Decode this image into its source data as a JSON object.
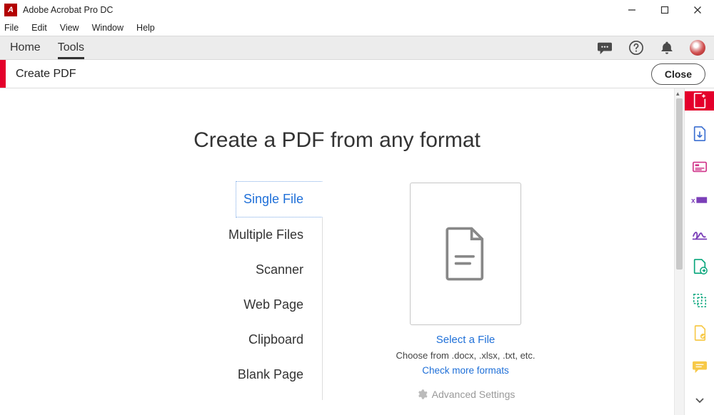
{
  "titlebar": {
    "app_name": "Adobe Acrobat Pro DC"
  },
  "menubar": {
    "items": [
      "File",
      "Edit",
      "View",
      "Window",
      "Help"
    ]
  },
  "tabsbar": {
    "home": "Home",
    "tools": "Tools",
    "active": "tools"
  },
  "toolheader": {
    "title": "Create PDF",
    "close": "Close"
  },
  "content": {
    "heading": "Create a PDF from any format",
    "options": [
      "Single File",
      "Multiple Files",
      "Scanner",
      "Web Page",
      "Clipboard",
      "Blank Page"
    ],
    "selected_index": 0,
    "select_file": "Select a File",
    "hint": "Choose from .docx, .xlsx, .txt, etc.",
    "more_formats": "Check more formats",
    "advanced": "Advanced Settings"
  },
  "rail": {
    "items": [
      "create-pdf",
      "export-pdf",
      "edit-pdf",
      "redact",
      "sign",
      "send-for-review",
      "compare",
      "stamp",
      "comment"
    ]
  },
  "colors": {
    "accent_red": "#e4002b",
    "link_blue": "#1e6fd8",
    "purple": "#7b3fb8",
    "green": "#08a67c",
    "yellow": "#f7c948"
  }
}
